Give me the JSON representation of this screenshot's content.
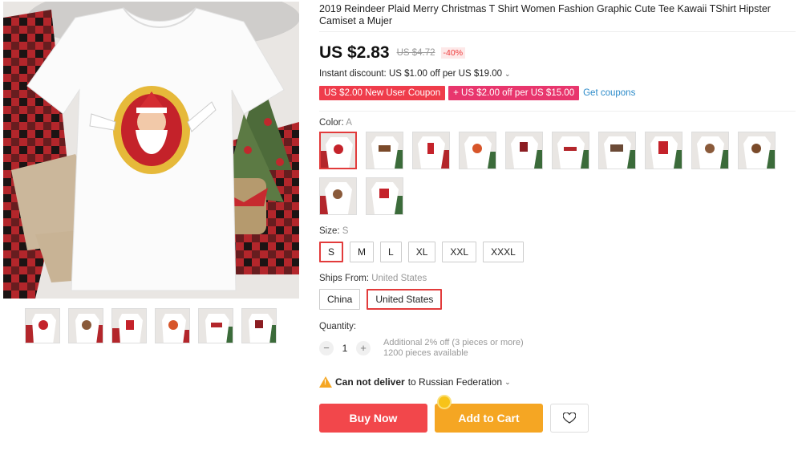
{
  "product": {
    "title": "2019 Reindeer Plaid Merry Christmas T Shirt Women Fashion Graphic Cute Tee Kawaii TShirt Hipster Camiset a Mujer",
    "price": "US $2.83",
    "old_price": "US $4.72",
    "discount": "-40%"
  },
  "promotions": {
    "instant_discount": "Instant discount: US $1.00 off per US $19.00",
    "coupons": [
      "US $2.00 New User Coupon",
      "+ US $2.00 off per US $15.00"
    ],
    "get_coupons": "Get coupons"
  },
  "color": {
    "label": "Color:",
    "selected": "A",
    "swatch_count": 12
  },
  "size": {
    "label": "Size:",
    "selected": "S",
    "options": [
      "S",
      "M",
      "L",
      "XL",
      "XXL",
      "XXXL"
    ]
  },
  "ships_from": {
    "label": "Ships From:",
    "selected": "United States",
    "options": [
      "China",
      "United States"
    ]
  },
  "quantity": {
    "label": "Quantity:",
    "value": "1",
    "note": "Additional 2% off (3 pieces or more)",
    "available": "1200 pieces available"
  },
  "delivery": {
    "warning": "Can not deliver",
    "to": "to Russian Federation"
  },
  "actions": {
    "buy_now": "Buy Now",
    "add_to_cart": "Add to Cart"
  },
  "gallery": {
    "thumbnail_count": 6
  },
  "colors": {
    "accent_red": "#e23b3b",
    "buy_now": "#f2474b",
    "add_to_cart": "#f5a623",
    "coupon_red": "#ef3c4b",
    "coupon_pink": "#e8366d",
    "link_blue": "#2a8ac9"
  },
  "icons": [
    "minus-icon",
    "plus-icon",
    "warning-icon",
    "heart-icon",
    "chevron-down-icon",
    "coin-icon"
  ]
}
